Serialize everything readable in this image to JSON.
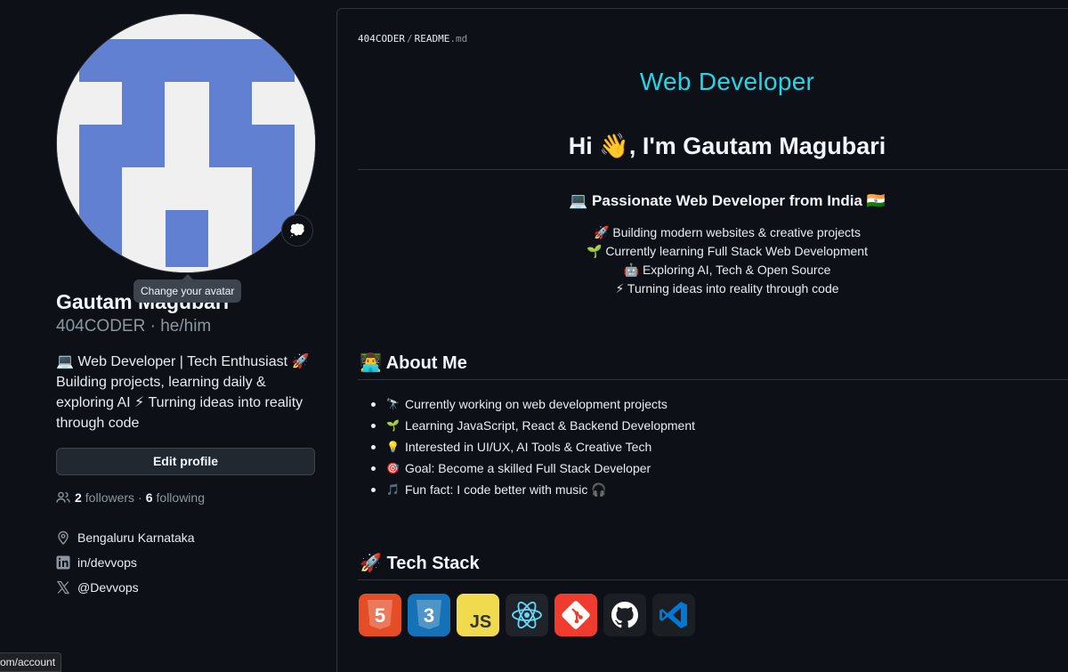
{
  "profile": {
    "name": "Gautam Magubari",
    "username": "404CODER",
    "pronouns": "he/him",
    "bio_lines": [
      "💻 Web Developer | Tech Enthusiast 🚀",
      "Building projects, learning daily &",
      "exploring AI ⚡ Turning ideas into reality",
      "through code"
    ],
    "avatar_tooltip": "Change your avatar",
    "status_emoji": "💭",
    "edit_label": "Edit profile",
    "followers_count": "2",
    "followers_label": "followers",
    "following_count": "6",
    "following_label": "following",
    "location": "Bengaluru Karnataka",
    "linkedin": "in/devvops",
    "twitter": "@Devvops"
  },
  "readme": {
    "breadcrumb_owner": "404CODER",
    "breadcrumb_file": "README",
    "breadcrumb_ext": ".md",
    "typing_text": "Web Developer",
    "greeting": "Hi 👋, I'm Gautam Magubari",
    "tagline": "💻 Passionate Web Developer from India 🇮🇳",
    "highlights": [
      "🚀 Building modern websites & creative projects",
      "🌱 Currently learning Full Stack Web Development",
      "🤖 Exploring AI, Tech & Open Source",
      "⚡ Turning ideas into reality through code"
    ],
    "about_heading": "👨‍💻 About Me",
    "about_items": [
      {
        "emoji": "🔭",
        "text": "Currently working on web development projects"
      },
      {
        "emoji": "🌱",
        "text": "Learning JavaScript, React & Backend Development"
      },
      {
        "emoji": "💡",
        "text": "Interested in UI/UX, AI Tools & Creative Tech"
      },
      {
        "emoji": "🎯",
        "text": "Goal: Become a skilled Full Stack Developer"
      },
      {
        "emoji": "🎵",
        "text": "Fun fact: I code better with music 🎧"
      }
    ],
    "tech_heading": "🚀 Tech Stack",
    "tech_icons": [
      "html5-icon",
      "css3-icon",
      "javascript-icon",
      "react-icon",
      "git-icon",
      "github-icon",
      "vscode-icon"
    ],
    "tech_labels": {
      "html_num": "5",
      "css_num": "3",
      "js": "JS"
    }
  },
  "status_url": "om/account",
  "colors": {
    "background": "#0d1117",
    "border": "#30363d",
    "typing": "#24d6e8",
    "avatar_blue": "#6180d2",
    "html": "#e44d26",
    "css": "#1572b6",
    "js": "#f0db4f",
    "react": "#61dafb",
    "git": "#f03c2e",
    "vscode": "#0078d4"
  }
}
